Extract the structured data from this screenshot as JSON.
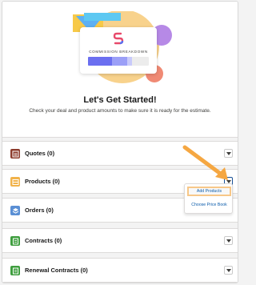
{
  "hero": {
    "card_title": "COMMISSION BREAKDOWN",
    "heading": "Let's Get Started!",
    "subtitle": "Check your deal and product amounts to make sure it is ready for the estimate."
  },
  "sections": [
    {
      "label": "Quotes (0)",
      "icon": "quote-icon",
      "color": "#8c3b2c"
    },
    {
      "label": "Products (0)",
      "icon": "product-icon",
      "color": "#f1b24a"
    },
    {
      "label": "Orders (0)",
      "icon": "order-icon",
      "color": "#5a8fd4"
    },
    {
      "label": "Contracts (0)",
      "icon": "contract-icon",
      "color": "#3f9e3f"
    },
    {
      "label": "Renewal Contracts (0)",
      "icon": "renewal-contract-icon",
      "color": "#3f9e3f"
    }
  ],
  "menu": {
    "add_products": "Add Products",
    "choose_price_book": "Choose Price Book"
  },
  "colors": {
    "accent_orange": "#f5a742",
    "link_blue": "#0b5cab"
  }
}
